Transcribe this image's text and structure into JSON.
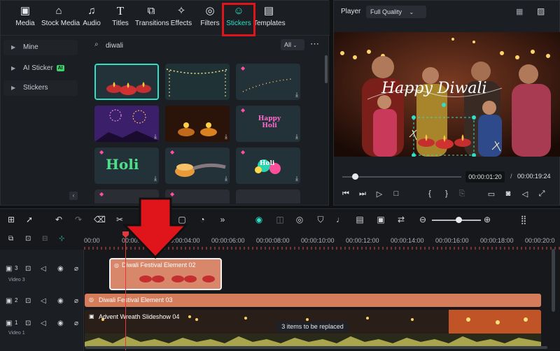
{
  "toolbar": {
    "items": [
      {
        "label": "Media",
        "icon": "media-icon"
      },
      {
        "label": "Stock Media",
        "icon": "stock-media-icon"
      },
      {
        "label": "Audio",
        "icon": "music-note-icon"
      },
      {
        "label": "Titles",
        "icon": "titles-icon"
      },
      {
        "label": "Transitions",
        "icon": "transitions-icon"
      },
      {
        "label": "Effects",
        "icon": "effects-icon"
      },
      {
        "label": "Filters",
        "icon": "filters-icon"
      },
      {
        "label": "Stickers",
        "icon": "stickers-icon"
      },
      {
        "label": "Templates",
        "icon": "templates-icon"
      }
    ],
    "active": "Stickers"
  },
  "sidebar": {
    "items": [
      {
        "label": "Mine"
      },
      {
        "label": "AI Sticker",
        "badge": "AI"
      },
      {
        "label": "Stickers"
      }
    ]
  },
  "search": {
    "value": "diwali"
  },
  "filter": {
    "value": "All"
  },
  "player": {
    "label": "Player",
    "quality": "Full Quality",
    "overlay_text": "Happy Diwali",
    "current_time": "00:00:01:20",
    "separator": "/",
    "total_time": "00:00:19:24",
    "progress": 0.09
  },
  "stickers_grid": {
    "tiles": [
      {
        "text": "",
        "selected": true
      },
      {
        "text": ""
      },
      {
        "text": ""
      },
      {
        "text": ""
      },
      {
        "text": ""
      },
      {
        "text": "Happy Holi"
      },
      {
        "text": "Holi"
      },
      {
        "text": ""
      },
      {
        "text": "Holi"
      }
    ]
  },
  "timeline": {
    "ruler": [
      "00:00",
      "00:00:02:00",
      "00:00:04:00",
      "00:00:06:00",
      "00:00:08:00",
      "00:00:10:00",
      "00:00:12:00",
      "00:00:14:00",
      "00:00:16:00",
      "00:00:18:00",
      "00:00:20:0"
    ],
    "tracks": [
      {
        "num": "3",
        "name": "Video 3"
      },
      {
        "num": "2",
        "name": ""
      },
      {
        "num": "1",
        "name": "Video 1"
      }
    ],
    "clips": {
      "v3": "Diwali Festival Element 02",
      "v2": "Diwali Festival Element 03",
      "v1": "Advent Wreath Slideshow 04"
    },
    "replace_tip": "3 items to be replaced"
  },
  "colors": {
    "accent": "#2ee0c8",
    "highlight_box": "#e0141b",
    "arrow": "#e0141b",
    "clip_orange": "#d57d5a"
  }
}
